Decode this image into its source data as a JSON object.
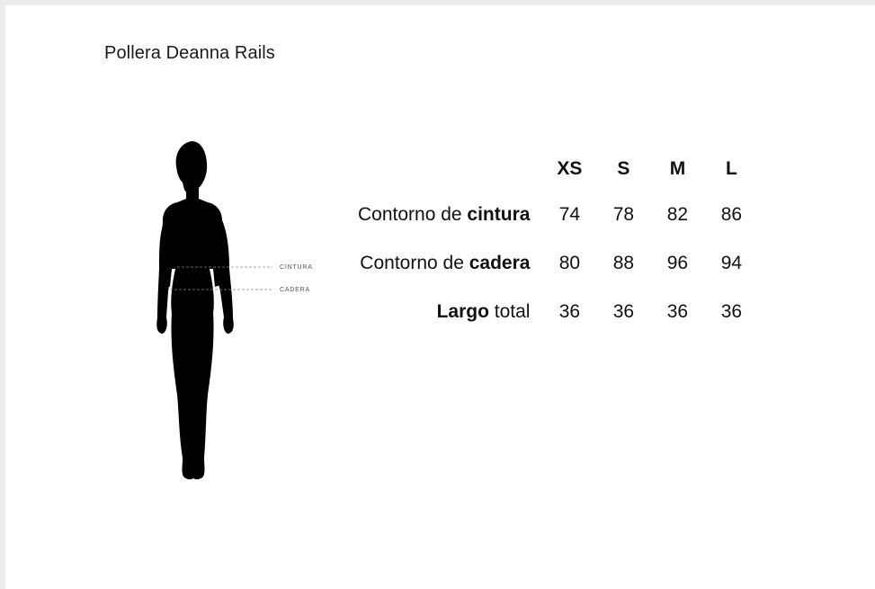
{
  "title": "Pollera Deanna Rails",
  "figure": {
    "markers": [
      "CINTURA",
      "CADERA"
    ]
  },
  "size_table": {
    "sizes": [
      "XS",
      "S",
      "M",
      "L"
    ],
    "rows": [
      {
        "label_pre": "Contorno de ",
        "label_bold": "cintura",
        "label_post": "",
        "values": [
          "74",
          "78",
          "82",
          "86"
        ]
      },
      {
        "label_pre": "Contorno de ",
        "label_bold": "cadera",
        "label_post": "",
        "values": [
          "80",
          "88",
          "96",
          "94"
        ]
      },
      {
        "label_pre": "",
        "label_bold": "Largo",
        "label_post": " total",
        "values": [
          "36",
          "36",
          "36",
          "36"
        ]
      }
    ]
  }
}
